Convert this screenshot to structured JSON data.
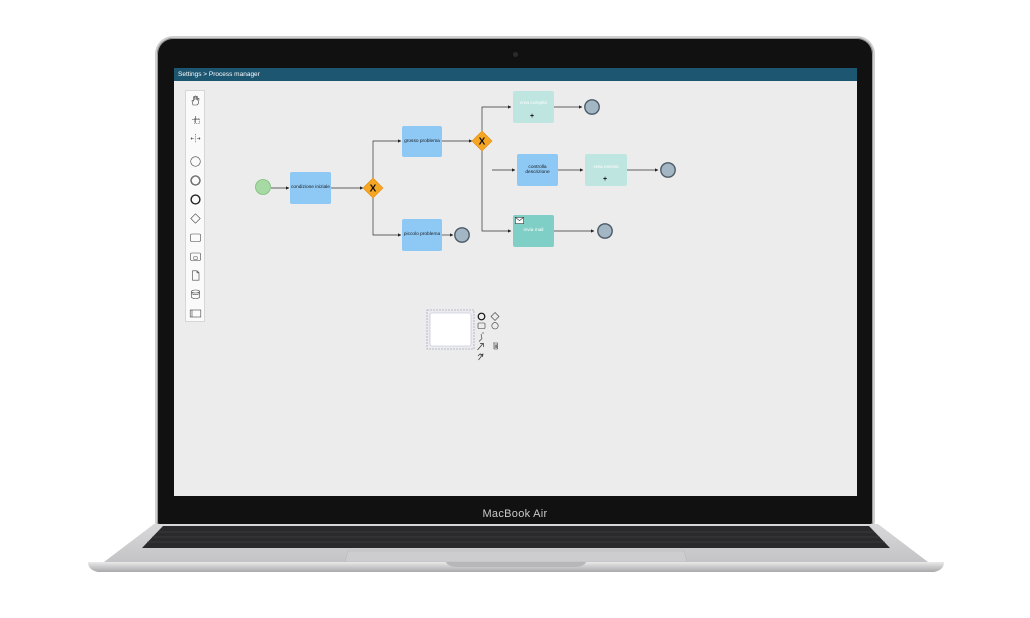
{
  "app": {
    "breadcrumb": "Settings > Process manager"
  },
  "device": {
    "brand_label": "MacBook Air"
  },
  "palette": {
    "tools": [
      "hand-tool-icon",
      "lasso-tool-icon",
      "space-tool-icon",
      "start-event-icon",
      "intermediate-event-icon",
      "end-event-icon",
      "gateway-icon",
      "task-icon",
      "subprocess-icon",
      "data-object-icon",
      "data-store-icon",
      "pool-icon"
    ]
  },
  "diagram": {
    "tasks": {
      "condizione_iniziale": "condizione iniziale",
      "grosso_problema": "grosso problema",
      "piccolo_problema": "piccolo problema",
      "crea_compito": "crea compito",
      "controlla_descrizione": "controlla descrizione",
      "crea_evento": "crea evento",
      "invia_mail": "invia mail"
    },
    "gateway_marker": "X",
    "subprocess_marker": "+"
  },
  "colors": {
    "titlebar": "#1d5670",
    "task_blue": "#8ec8f5",
    "task_teal": "#7fcfc6",
    "task_pale": "#bfe5e1",
    "gateway": "#f6a623",
    "start_event": "#a6d9a3",
    "end_event": "#a3b6c4",
    "canvas": "#ececec"
  }
}
